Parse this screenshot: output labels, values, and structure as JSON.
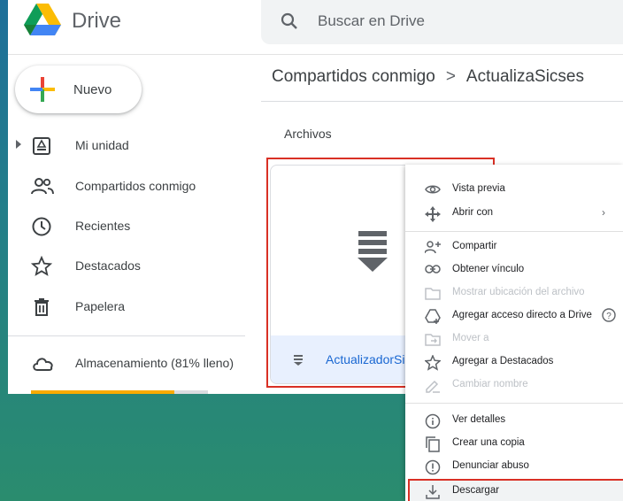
{
  "header": {
    "brand": "Drive",
    "search_placeholder": "Buscar en Drive"
  },
  "sidebar": {
    "new_label": "Nuevo",
    "items": [
      {
        "label": "Mi unidad",
        "icon": "drive-icon"
      },
      {
        "label": "Compartidos conmigo",
        "icon": "people-icon"
      },
      {
        "label": "Recientes",
        "icon": "clock-icon"
      },
      {
        "label": "Destacados",
        "icon": "star-icon"
      },
      {
        "label": "Papelera",
        "icon": "trash-icon"
      }
    ],
    "storage": {
      "label": "Almacenamiento (81% lleno)",
      "used_fraction": 0.81
    }
  },
  "breadcrumb": {
    "parent": "Compartidos conmigo",
    "current": "ActualizaSicses"
  },
  "main": {
    "section_title": "Archivos",
    "file": {
      "name": "ActualizadorSicses",
      "icon": "archive-file-icon"
    }
  },
  "context_menu": {
    "items": [
      {
        "label": "Vista previa",
        "icon": "eye-icon",
        "enabled": true
      },
      {
        "label": "Abrir con",
        "icon": "move-icon",
        "enabled": true,
        "submenu": "›"
      },
      {
        "label": "Compartir",
        "icon": "person-add-icon",
        "enabled": true
      },
      {
        "label": "Obtener vínculo",
        "icon": "link-icon",
        "enabled": true
      },
      {
        "label": "Mostrar ubicación del archivo",
        "icon": "folder-icon",
        "enabled": false
      },
      {
        "label": "Agregar acceso directo a Drive",
        "icon": "shortcut-icon",
        "enabled": true
      },
      {
        "label": "Mover a",
        "icon": "move-to-icon",
        "enabled": false
      },
      {
        "label": "Agregar a Destacados",
        "icon": "star-icon",
        "enabled": true
      },
      {
        "label": "Cambiar nombre",
        "icon": "pencil-icon",
        "enabled": false
      },
      {
        "label": "Ver detalles",
        "icon": "info-icon",
        "enabled": true
      },
      {
        "label": "Crear una copia",
        "icon": "copy-icon",
        "enabled": true
      },
      {
        "label": "Denunciar abuso",
        "icon": "report-icon",
        "enabled": true
      },
      {
        "label": "Descargar",
        "icon": "download-icon",
        "enabled": true
      }
    ],
    "help_glyph": "?"
  },
  "colors": {
    "highlight": "#d93025",
    "link": "#1967d2",
    "storage": "#f9ab00"
  }
}
